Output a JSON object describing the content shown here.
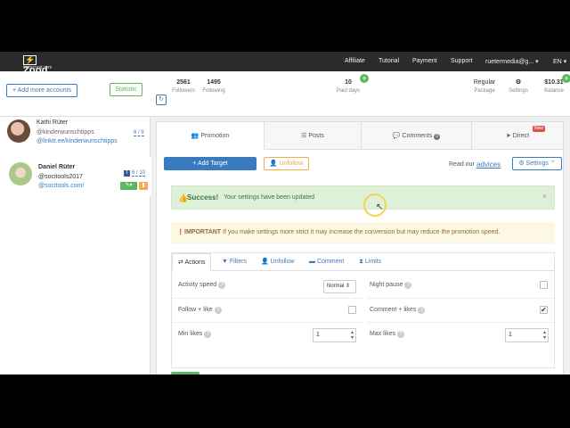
{
  "topnav": {
    "logo_text": "Zood",
    "logo_subtitle": "instazood.com",
    "links": [
      "Affiliate",
      "Tutorial",
      "Payment",
      "Support"
    ],
    "user": "ruetermedia@g...",
    "language": "EN"
  },
  "header": {
    "add_accounts_label": "+ Add more accounts",
    "statistic_label": "Statistic",
    "followers": {
      "value": "2561",
      "label": "Followers"
    },
    "following": {
      "value": "1495",
      "label": "Following"
    },
    "paid_days": {
      "value": "10",
      "label": "Paid days"
    },
    "package": {
      "value": "Regular",
      "label": "Package"
    },
    "settings_label": "Settings",
    "balance": {
      "value": "$10.31",
      "label": "Balance"
    }
  },
  "accounts": [
    {
      "name": "Kathi Rüter",
      "username": "@kinderwunschtipps",
      "link": "@linktr.ee/kinderwunschtipps",
      "count": "6 / 9"
    },
    {
      "name": "Daniel Rüter",
      "username": "@socitools2017",
      "link": "@socitools.com/",
      "count": "6 / 10"
    }
  ],
  "tabs": [
    {
      "label": "Promotion",
      "icon": "users-icon"
    },
    {
      "label": "Posts",
      "icon": "list-icon"
    },
    {
      "label": "Comments",
      "icon": "comment-icon",
      "badge": "0"
    },
    {
      "label": "Direct",
      "icon": "send-icon",
      "badge": "New"
    }
  ],
  "promotion": {
    "add_target_label": "+ Add Target",
    "unfollow_label": "Unfollow",
    "read_our": "Read our",
    "advices": "advices",
    "settings_label": "Settings",
    "success_title": "Success!",
    "success_text": "Your settings have been updated",
    "important_title": "IMPORTANT",
    "important_text": "If you make settings more strict it may increase the conversion but may reduce the promotion speed."
  },
  "subtabs": [
    "Actions",
    "Filters",
    "Unfollow",
    "Comment",
    "Limits"
  ],
  "settings": {
    "activity_speed_label": "Activity speed",
    "activity_speed_value": "Normal",
    "night_pause_label": "Night pause",
    "night_pause_checked": false,
    "follow_like_label": "Follow + like",
    "follow_like_checked": false,
    "comment_likes_label": "Comment + likes",
    "comment_likes_checked": true,
    "min_likes_label": "Min likes",
    "min_likes_value": "1",
    "max_likes_label": "Max likes",
    "max_likes_value": "1"
  },
  "colors": {
    "primary": "#3a7bbf",
    "success": "#5cb85c",
    "warning": "#f0ad4e",
    "nav_bg": "#2b2b2b"
  }
}
